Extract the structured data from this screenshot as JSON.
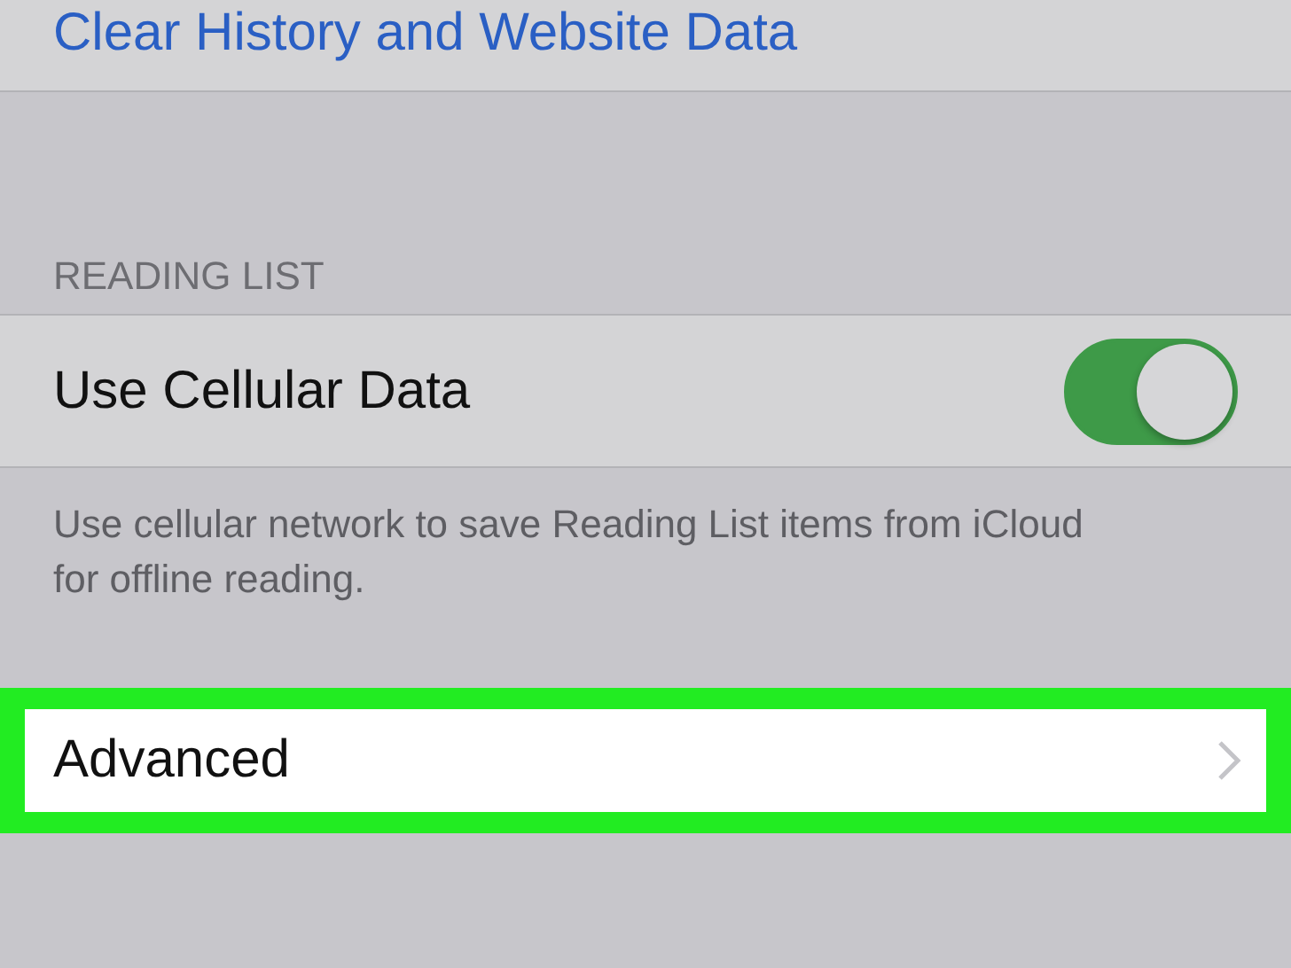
{
  "clear_history": {
    "label": "Clear History and Website Data"
  },
  "reading_list": {
    "header": "READING LIST",
    "rows": [
      {
        "kind": "toggle",
        "label": "Use Cellular Data",
        "on": true
      }
    ],
    "footer": "Use cellular network to save Reading List items from iCloud for offline reading."
  },
  "advanced": {
    "label": "Advanced",
    "highlighted": true
  }
}
